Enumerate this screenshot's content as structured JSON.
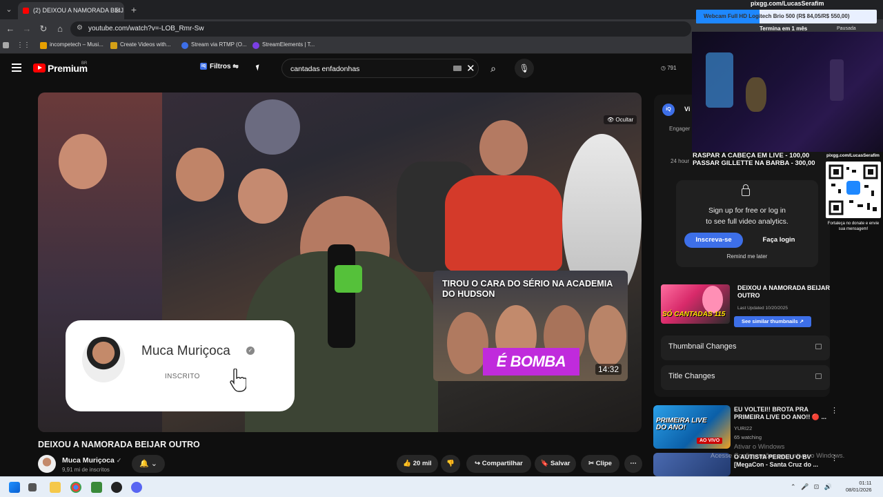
{
  "browser": {
    "tab_title": "(2) DEIXOU A NAMORADA BEIJ...",
    "url": "youtube.com/watch?v=-LOB_Rmr-Sw",
    "bookmarks": [
      {
        "label": "incompetech – Musi...",
        "color": "#e8a000"
      },
      {
        "label": "Create Videos with...",
        "color": "#d4a017"
      },
      {
        "label": "Stream via RTMP (O...",
        "color": "#3d6fe8"
      },
      {
        "label": "StreamElements | T...",
        "color": "#7b3fe4"
      }
    ]
  },
  "header": {
    "logo_text": "Premium",
    "region": "BR",
    "filters_label": "Filtros",
    "search_value": "cantadas enfadonhas",
    "views_chip": "791"
  },
  "player": {
    "hide_label": "Ocultar",
    "subscribe_card": {
      "name": "Muca Muriçoca",
      "status": "INSCRITO"
    },
    "endcard": {
      "title": "TIROU O CARA DO SÉRIO NA ACADEMIA DO HUDSON",
      "banner": "É BOMBA",
      "duration": "14:32"
    }
  },
  "video": {
    "title": "DEIXOU A NAMORADA BEIJAR OUTRO",
    "channel": "Muca Muriçoca",
    "subscribers": "9,91 mi de inscritos",
    "likes": "20 mil",
    "share": "Compartilhar",
    "save": "Salvar",
    "clip": "Clipe"
  },
  "vidiq": {
    "tab": "Vi",
    "engagement": "Engager",
    "hours": "24 hour",
    "lock_text": [
      "Sign up for free or log in",
      "to see full video analytics."
    ],
    "signup_btn": "Inscreva-se",
    "login_btn": "Faça login",
    "remind": "Remind me later",
    "thumb": {
      "title": "DEIXOU A NAMORADA BEIJAR OUTRO",
      "thumb_text": "SÓ CANTADAS 115",
      "updated": "Last Updated 10/20/2025",
      "similar_btn": "See similar thumbnails ↗"
    },
    "rows": [
      "Thumbnail Changes",
      "Title Changes"
    ]
  },
  "recommendations": [
    {
      "title": "EU VOLTEI!! BROTA PRA PRIMEIRA LIVE DO ANO!! 🔴 ...",
      "meta1": "YURI22",
      "meta2": "65 watching",
      "live": "AO VIVO"
    },
    {
      "title": "O AUTISTA PERDEU O BV [MegaCon - Santa Cruz do ...",
      "meta1": "Muca Muriçoca",
      "meta2": ""
    }
  ],
  "windows_watermark": [
    "Ativar o Windows",
    "Acesse Configurações para ativar o Windows."
  ],
  "stream_overlay": {
    "url": "pixgg.com/LucasSerafim",
    "webcam_banner": "Webcam Full HD Logitech Brio 500 (R$ 84,05/R$ 550,00)",
    "timer": "Termina em 1 mês",
    "paused": "Pausada",
    "goals": [
      "RASPAR A CABEÇA EM LIVE - 100,00",
      "PASSAR GILLETTE NA BARBA - 300,00"
    ],
    "qr_url": "pixgg.com/LucasSerafim",
    "qr_note": "Fortaleça no donate e envie sua mensagem!"
  },
  "taskbar": {
    "time": "01:11",
    "date": "08/01/2026"
  }
}
